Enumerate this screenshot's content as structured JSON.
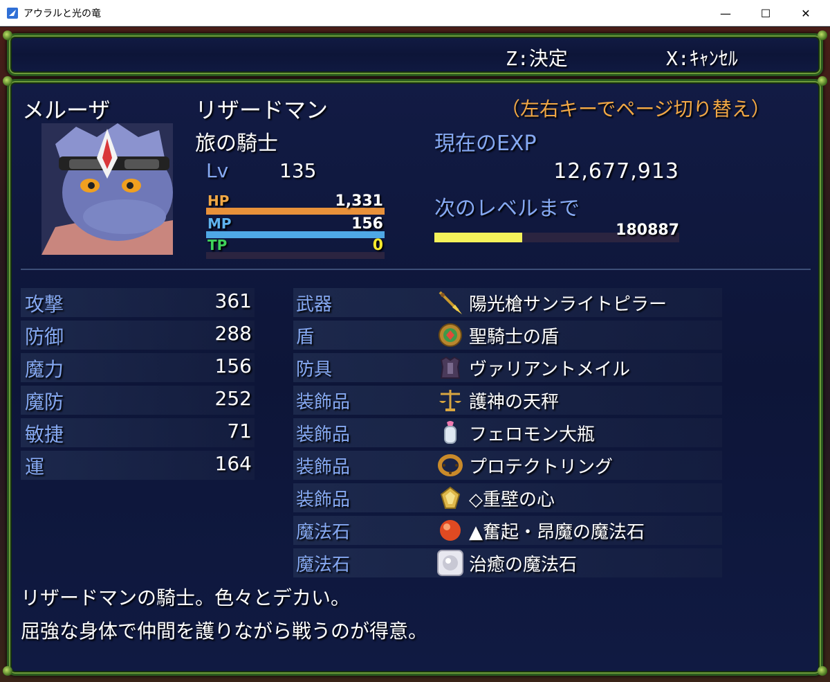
{
  "window": {
    "title": "アウラルと光の竜",
    "min": "—",
    "max": "☐",
    "close": "✕"
  },
  "help": {
    "confirm": "Z:決定",
    "cancel": "X:ｷｬﾝｾﾙ"
  },
  "actor": {
    "name": "メルーザ",
    "class": "リザードマン",
    "nickname": "旅の騎士",
    "level_label": "Lv",
    "level": "135",
    "page_hint": "（左右キーでページ切り替え）"
  },
  "gauges": {
    "hp": {
      "label": "HP",
      "value": "1,331",
      "fill": 1.0,
      "color": "#e8913a"
    },
    "mp": {
      "label": "MP",
      "value": "156",
      "fill": 1.0,
      "color": "#4fa8e6"
    },
    "tp": {
      "label": "TP",
      "value": "0",
      "fill": 0.0,
      "color": "#3fd35a"
    }
  },
  "exp": {
    "current_label": "現在のEXP",
    "current_value": "12,677,913",
    "next_label": "次のレベルまで",
    "next_value": "180887",
    "next_fill": 0.36,
    "bar_color": "#f4f25a"
  },
  "stats": [
    {
      "label": "攻撃",
      "value": "361"
    },
    {
      "label": "防御",
      "value": "288"
    },
    {
      "label": "魔力",
      "value": "156"
    },
    {
      "label": "魔防",
      "value": "252"
    },
    {
      "label": "敏捷",
      "value": "71"
    },
    {
      "label": "運",
      "value": "164"
    }
  ],
  "equipment": [
    {
      "slot": "武器",
      "item": "陽光槍サンライトピラー",
      "icon": "spear-icon"
    },
    {
      "slot": "盾",
      "item": "聖騎士の盾",
      "icon": "shield-icon"
    },
    {
      "slot": "防具",
      "item": "ヴァリアントメイル",
      "icon": "armor-icon"
    },
    {
      "slot": "装飾品",
      "item": "護神の天秤",
      "icon": "scales-icon"
    },
    {
      "slot": "装飾品",
      "item": "フェロモン大瓶",
      "icon": "bottle-icon"
    },
    {
      "slot": "装飾品",
      "item": "プロテクトリング",
      "icon": "ring-icon"
    },
    {
      "slot": "装飾品",
      "item": "◇重壁の心",
      "icon": "gem-icon"
    },
    {
      "slot": "魔法石",
      "item": "▲奮起・昂魔の魔法石",
      "icon": "red-orb-icon"
    },
    {
      "slot": "魔法石",
      "item": "治癒の魔法石",
      "icon": "white-orb-icon"
    }
  ],
  "profile": {
    "line1": "リザードマンの騎士。色々とデカい。",
    "line2": "屈強な身体で仲間を護りながら戦うのが得意。"
  }
}
